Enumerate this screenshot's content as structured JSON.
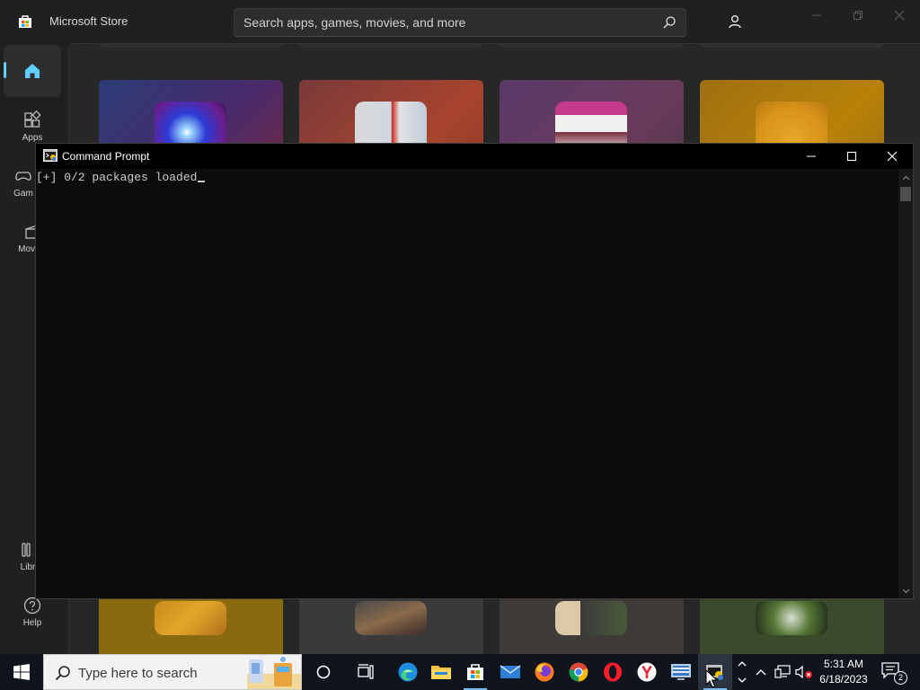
{
  "store": {
    "title": "Microsoft Store",
    "search_placeholder": "Search apps, games, movies, and more",
    "nav": [
      {
        "label": ""
      },
      {
        "label": "Apps"
      },
      {
        "label": "Gam"
      },
      {
        "label": "Movies"
      },
      {
        "label": "Libr"
      },
      {
        "label": "Help"
      }
    ]
  },
  "cmd": {
    "title": "Command Prompt",
    "output_line": "[+] 0/2 packages loaded"
  },
  "taskbar": {
    "search_placeholder": "Type here to search",
    "clock_time": "5:31 AM",
    "clock_date": "6/18/2023",
    "notification_count": "2"
  },
  "colors": {
    "accent": "#60cdff",
    "store_bg": "#202020",
    "console_bg": "#0c0c0c",
    "taskbar_bg": "#10151d"
  }
}
